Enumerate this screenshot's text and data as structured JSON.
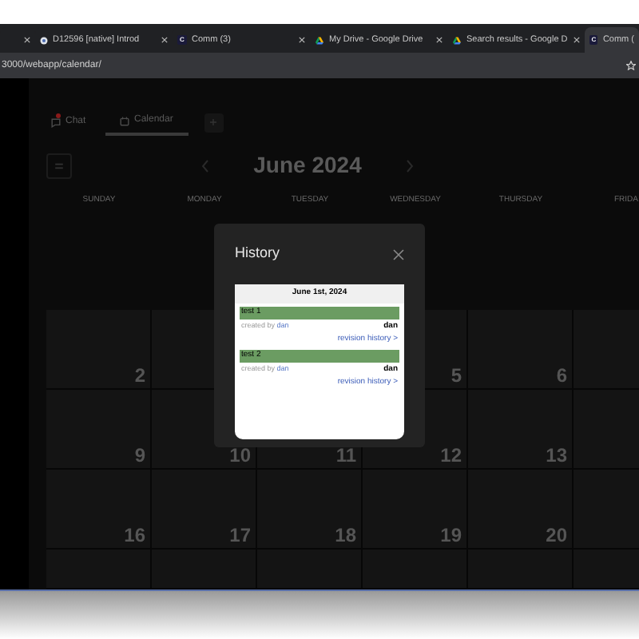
{
  "browser": {
    "tabs": [
      {
        "kind": "partial",
        "selected": false
      },
      {
        "kind": "site",
        "title": "D12596 [native] Introd",
        "selected": false
      },
      {
        "kind": "letter",
        "favicon": "C",
        "title": "Comm (3)",
        "selected": false
      },
      {
        "kind": "drive",
        "title": "My Drive - Google Drive",
        "selected": false
      },
      {
        "kind": "drive",
        "title": "Search results - Google D",
        "selected": false
      },
      {
        "kind": "letter",
        "favicon": "C",
        "title": "Comm (",
        "selected": true
      }
    ],
    "address": "3000/webapp/calendar/"
  },
  "app": {
    "nav_tabs": [
      {
        "kind": "chat",
        "label": "Chat",
        "badge": true,
        "selected": false
      },
      {
        "kind": "calendar",
        "label": "Calendar",
        "badge": false,
        "selected": true
      }
    ],
    "month": "June 2024",
    "weekdays": [
      "SUNDAY",
      "MONDAY",
      "TUESDAY",
      "WEDNESDAY",
      "THURSDAY",
      "FRIDA"
    ],
    "weeks": [
      [
        {
          "kind": "number",
          "day": "2"
        },
        {
          "kind": "blank"
        },
        {
          "kind": "blank"
        },
        {
          "kind": "number",
          "day": "5"
        },
        {
          "kind": "number",
          "day": "6"
        },
        {
          "kind": "blank"
        }
      ],
      [
        {
          "kind": "number",
          "day": "9"
        },
        {
          "kind": "number",
          "day": "10"
        },
        {
          "kind": "number",
          "day": "11"
        },
        {
          "kind": "number",
          "day": "12"
        },
        {
          "kind": "number",
          "day": "13"
        },
        {
          "kind": "blank"
        }
      ],
      [
        {
          "kind": "number",
          "day": "16"
        },
        {
          "kind": "number",
          "day": "17"
        },
        {
          "kind": "number",
          "day": "18"
        },
        {
          "kind": "number",
          "day": "19"
        },
        {
          "kind": "number",
          "day": "20"
        },
        {
          "kind": "blank"
        }
      ],
      [
        {
          "kind": "blank"
        },
        {
          "kind": "blank"
        },
        {
          "kind": "blank"
        },
        {
          "kind": "blank"
        },
        {
          "kind": "blank"
        },
        {
          "kind": "blank"
        }
      ]
    ]
  },
  "dialog": {
    "title": "History",
    "date": "June 1st, 2024",
    "entries": [
      {
        "title": "test 1",
        "created_label": "created by",
        "created_by": "dan",
        "user": "dan",
        "link": "revision history >"
      },
      {
        "title": "test 2",
        "created_label": "created by",
        "created_by": "dan",
        "user": "dan",
        "link": "revision history >"
      }
    ]
  }
}
